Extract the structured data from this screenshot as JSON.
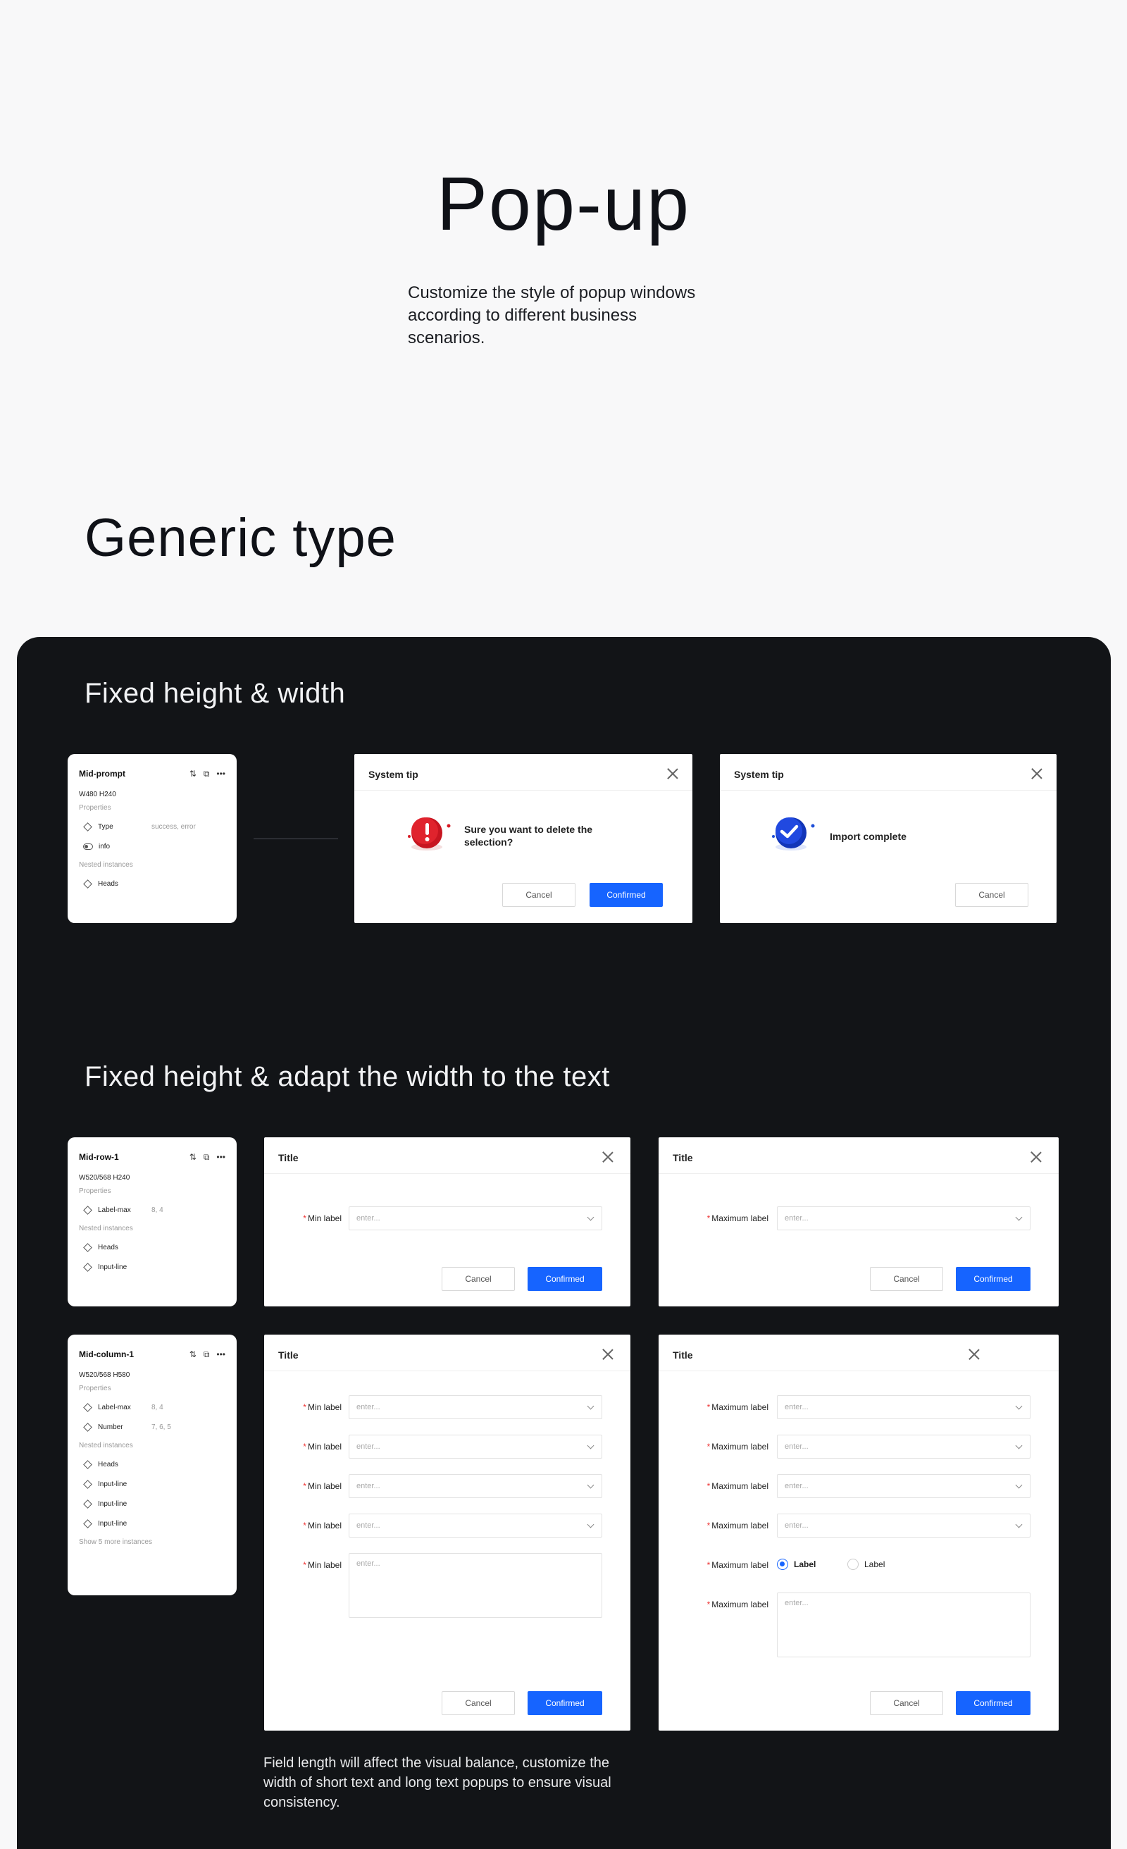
{
  "hero": {
    "title": "Pop-up",
    "description": "Customize the style of popup windows according to different business scenarios."
  },
  "section_title": "Generic type",
  "fixed_section": {
    "title": "Fixed height & width",
    "card": {
      "name": "Mid-prompt",
      "size": "W480 H240",
      "properties_label": "Properties",
      "props": [
        {
          "label": "Type",
          "value": "success, error"
        },
        {
          "label": "info",
          "value": ""
        }
      ],
      "nested_label": "Nested instances",
      "nested": [
        "Heads"
      ]
    },
    "dialog_error": {
      "title": "System tip",
      "message": "Sure you want to delete the selection?",
      "cancel": "Cancel",
      "confirm": "Confirmed"
    },
    "dialog_success": {
      "title": "System tip",
      "message": "Import complete",
      "cancel": "Cancel"
    }
  },
  "adapt_section": {
    "title": "Fixed height & adapt the width to the text",
    "row_card": {
      "name": "Mid-row-1",
      "size": "W520/568 H240",
      "properties_label": "Properties",
      "props": [
        {
          "label": "Label-max",
          "value": "8, 4"
        }
      ],
      "nested_label": "Nested instances",
      "nested": [
        "Heads",
        "Input-line"
      ]
    },
    "column_card": {
      "name": "Mid-column-1",
      "size": "W520/568 H580",
      "properties_label": "Properties",
      "props": [
        {
          "label": "Label-max",
          "value": "8, 4"
        },
        {
          "label": "Number",
          "value": "7, 6, 5"
        }
      ],
      "nested_label": "Nested instances",
      "nested": [
        "Heads",
        "Input-line",
        "Input-line",
        "Input-line"
      ],
      "more": "Show 5 more instances"
    },
    "row_min": {
      "title": "Title",
      "field_label": "Min label",
      "placeholder": "enter...",
      "cancel": "Cancel",
      "confirm": "Confirmed"
    },
    "row_max": {
      "title": "Title",
      "field_label": "Maximum label",
      "placeholder": "enter...",
      "cancel": "Cancel",
      "confirm": "Confirmed"
    },
    "col_min": {
      "title": "Title",
      "field_label": "Min label",
      "placeholder": "enter...",
      "cancel": "Cancel",
      "confirm": "Confirmed"
    },
    "col_max": {
      "title": "Title",
      "field_label": "Maximum label",
      "placeholder": "enter...",
      "radio_a": "Label",
      "radio_b": "Label",
      "cancel": "Cancel",
      "confirm": "Confirmed"
    }
  },
  "footnote": "Field length will affect the visual balance, customize the width of short text and long text popups to ensure visual consistency.",
  "colors": {
    "primary": "#1664ff",
    "panel": "#121417",
    "error": "#d81b25"
  }
}
